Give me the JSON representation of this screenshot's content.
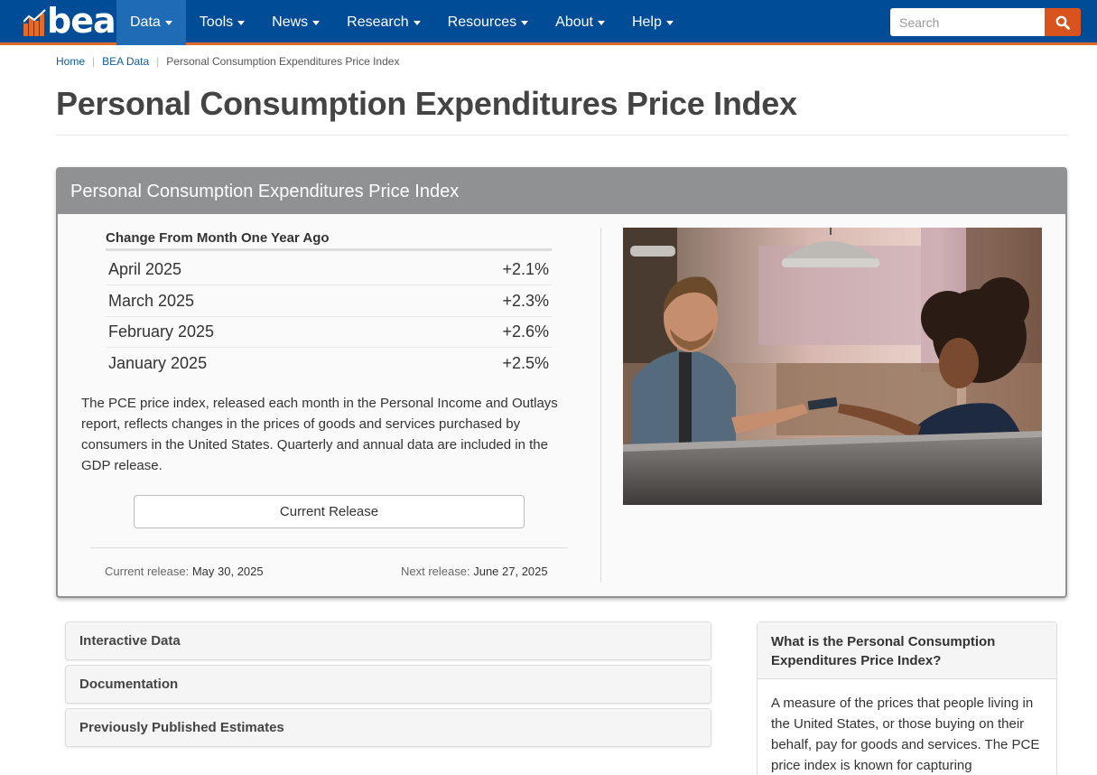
{
  "nav": {
    "logo_text": "bea",
    "items": [
      {
        "label": "Data",
        "active": true
      },
      {
        "label": "Tools"
      },
      {
        "label": "News"
      },
      {
        "label": "Research"
      },
      {
        "label": "Resources"
      },
      {
        "label": "About"
      },
      {
        "label": "Help"
      }
    ],
    "search_placeholder": "Search"
  },
  "breadcrumb": [
    "Home",
    "BEA Data",
    "Personal Consumption Expenditures Price Index"
  ],
  "page_title": "Personal Consumption Expenditures Price Index",
  "panel": {
    "title": "Personal Consumption Expenditures Price Index",
    "table_header": "Change From Month One Year Ago",
    "rows": [
      {
        "month": "April 2025",
        "change": "+2.1%"
      },
      {
        "month": "March 2025",
        "change": "+2.3%"
      },
      {
        "month": "February 2025",
        "change": "+2.6%"
      },
      {
        "month": "January 2025",
        "change": "+2.5%"
      }
    ],
    "description": "The PCE price index, released each month in the Personal Income and Outlays report, reflects changes in the prices of goods and services purchased by consumers in the United States. Quarterly and annual data are included in the GDP release.",
    "button_label": "Current Release",
    "current_release_label": "Current release:",
    "current_release_date": "May 30, 2025",
    "next_release_label": "Next release:",
    "next_release_date": "June 27, 2025"
  },
  "accordions": [
    "Interactive Data",
    "Documentation",
    "Previously Published Estimates"
  ],
  "sidebar": {
    "title": "What is the Personal Consumption Expenditures Price Index?",
    "body": "A measure of the prices that people living in the United States, or those buying on their behalf, pay for goods and services. The PCE price index is known for capturing"
  },
  "colors": {
    "nav_bg": "#004c97",
    "nav_accent": "#e06c2b",
    "search_button": "#d9531e",
    "panel_header": "#8f9193"
  }
}
